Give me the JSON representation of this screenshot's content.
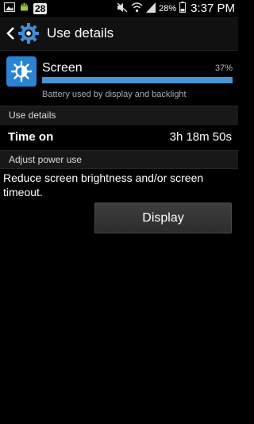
{
  "status_bar": {
    "notification_count": "28",
    "battery_percent": "28%",
    "time": "3:37 PM",
    "icons": [
      "gallery-icon",
      "android-icon",
      "mute-icon",
      "wifi-icon",
      "signal-icon",
      "battery-icon"
    ]
  },
  "action_bar": {
    "title": "Use details",
    "icons": [
      "back-chevron-icon",
      "gear-icon"
    ]
  },
  "app": {
    "name": "Screen",
    "percent": "37%",
    "usage_fraction": 1.0,
    "description": "Battery used by display and backlight",
    "icon": "brightness-icon",
    "icon_color": "#2a84d4",
    "bar_color": "#4795d4"
  },
  "use_details": {
    "header": "Use details",
    "time_on_label": "Time on",
    "time_on_value": "3h 18m 50s"
  },
  "adjust": {
    "header": "Adjust power use",
    "advice": "Reduce screen brightness and/or screen timeout.",
    "button_label": "Display"
  }
}
